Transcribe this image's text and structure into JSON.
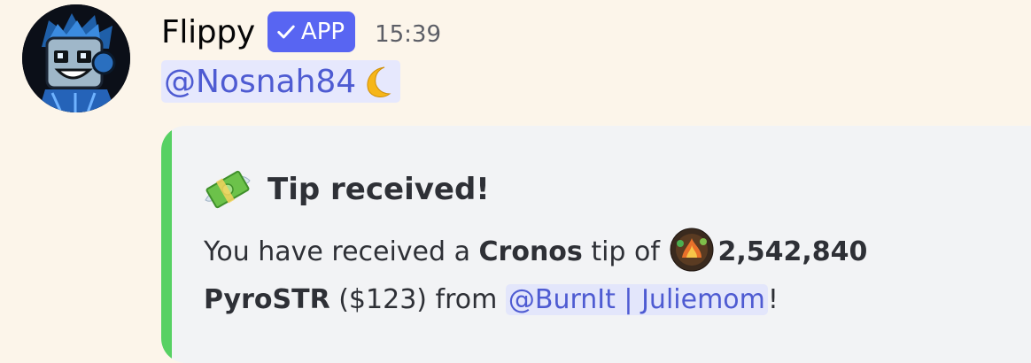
{
  "message": {
    "username": "Flippy",
    "badge": "APP",
    "timestamp": "15:39",
    "mention": "@Nosnah84",
    "mention_emoji": "crescent-moon"
  },
  "embed": {
    "accent_color": "#57d163",
    "title_icon": "money-with-wings",
    "title": "Tip received!",
    "desc_prefix": "You have received a ",
    "network": "Cronos",
    "desc_mid": " tip of ",
    "token_icon": "pyrostr-token",
    "amount": "2,542,840",
    "token": "PyroSTR",
    "usd": " ($123) from ",
    "sender": "@BurnIt | Juliemom",
    "suffix": "!"
  },
  "colors": {
    "background": "#fcf5ea",
    "badge": "#5865f2",
    "mention_text": "#4e5bd2",
    "mention_bg": "#e6e8fd",
    "embed_bg": "#f2f3f5"
  }
}
